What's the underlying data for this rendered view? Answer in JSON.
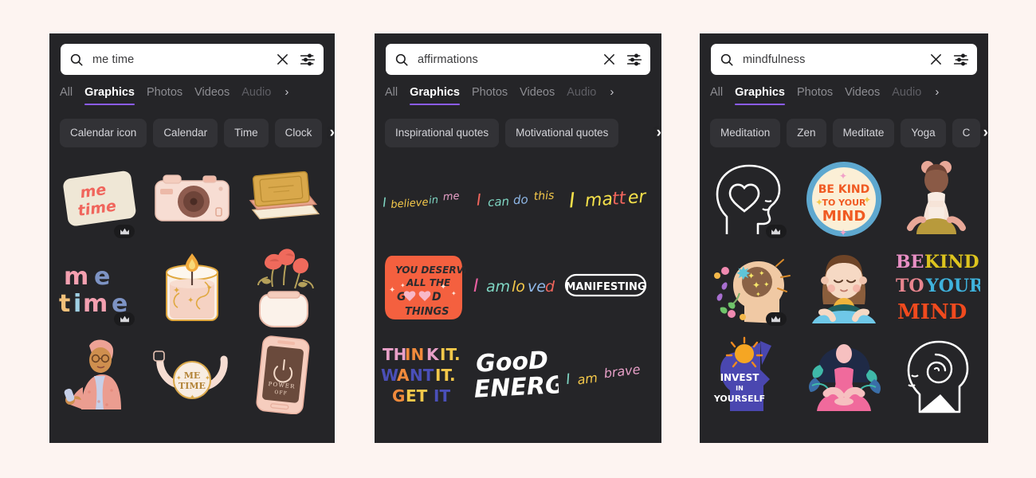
{
  "page": {
    "background": "#fdf4f1",
    "panel_background": "#252528",
    "accent": "#8b5cf6"
  },
  "panels": [
    {
      "id": "panel-me-time",
      "search": {
        "value": "me time",
        "placeholder": "Search",
        "search_icon": "search-icon",
        "clear_icon": "close-icon",
        "filter_icon": "sliders-icon"
      },
      "tabs": [
        {
          "label": "All",
          "active": false,
          "faded": false
        },
        {
          "label": "Graphics",
          "active": true,
          "faded": false
        },
        {
          "label": "Photos",
          "active": false,
          "faded": false
        },
        {
          "label": "Videos",
          "active": false,
          "faded": false
        },
        {
          "label": "Audio",
          "active": false,
          "faded": true
        }
      ],
      "tabs_more": "›",
      "chips": [
        "Calendar icon",
        "Calendar",
        "Time",
        "Clock"
      ],
      "chips_more": "›",
      "results": [
        {
          "name": "me-time-lettering-card",
          "premium": true
        },
        {
          "name": "pink-camera",
          "premium": false
        },
        {
          "name": "stacked-books",
          "premium": false
        },
        {
          "name": "me-time-bubble-lettering",
          "premium": true
        },
        {
          "name": "lit-candle",
          "premium": false
        },
        {
          "name": "flowers-in-vase",
          "premium": false
        },
        {
          "name": "woman-in-robe-reading",
          "premium": false
        },
        {
          "name": "me-time-badge-hands",
          "premium": false
        },
        {
          "name": "phone-power-off",
          "premium": false
        }
      ]
    },
    {
      "id": "panel-affirmations",
      "search": {
        "value": "affirmations",
        "placeholder": "Search",
        "search_icon": "search-icon",
        "clear_icon": "close-icon",
        "filter_icon": "sliders-icon"
      },
      "tabs": [
        {
          "label": "All",
          "active": false,
          "faded": false
        },
        {
          "label": "Graphics",
          "active": true,
          "faded": false
        },
        {
          "label": "Photos",
          "active": false,
          "faded": false
        },
        {
          "label": "Videos",
          "active": false,
          "faded": false
        },
        {
          "label": "Audio",
          "active": false,
          "faded": true
        }
      ],
      "tabs_more": "›",
      "chips": [
        "Inspirational quotes",
        "Motivational quotes"
      ],
      "chips_more": "›",
      "text_results": [
        [
          {
            "text": "I believe in me",
            "name": "i-believe-in-me-lettering",
            "colors": [
              "#7fd6c3",
              "#f4c84a",
              "#7fd6c3",
              "#e8a0c8"
            ],
            "size": 15,
            "style": "script"
          },
          {
            "text": "I can do this",
            "name": "i-can-do-this-lettering",
            "colors": [
              "#f0655c",
              "#7fd6c3",
              "#8fb8e8",
              "#f4c84a"
            ],
            "size": 17,
            "style": "script"
          },
          {
            "text": "I matter",
            "name": "i-matter-lettering",
            "colors": [
              "#f4e04a",
              "#f4e04a",
              "#f0655c"
            ],
            "size": 23,
            "style": "script"
          }
        ],
        [
          {
            "text": "YOU DESERVE ALL THE GOOD THINGS",
            "name": "you-deserve-all-the-good-things-sticker",
            "colors": [
              "#f4603f"
            ],
            "size": 12,
            "style": "badge"
          },
          {
            "text": "I am loved",
            "name": "i-am-loved-lettering",
            "colors": [
              "#e85fa0",
              "#7fd6c3",
              "#f4c84a",
              "#8fb8e8",
              "#f0655c"
            ],
            "size": 20,
            "style": "script"
          },
          {
            "text": "MANIFESTING",
            "name": "manifesting-sticker",
            "colors": [
              "#ffffff"
            ],
            "size": 13,
            "style": "outline"
          }
        ],
        [
          {
            "text": "THINK IT. WANT IT. GET IT",
            "name": "think-it-want-it-get-it-lettering",
            "colors": [
              "#e8a0c8",
              "#f08a3c",
              "#4a4fb8",
              "#f4c84a",
              "#f0655c"
            ],
            "size": 19,
            "style": "block"
          },
          {
            "text": "GOOD ENERGY",
            "name": "good-energy-lettering",
            "colors": [
              "#ffffff"
            ],
            "size": 26,
            "style": "brush"
          },
          {
            "text": "I am brave",
            "name": "i-am-brave-lettering",
            "colors": [
              "#7fd6c3",
              "#f4c84a",
              "#e8a0c8"
            ],
            "size": 16,
            "style": "script"
          }
        ]
      ]
    },
    {
      "id": "panel-mindfulness",
      "search": {
        "value": "mindfulness",
        "placeholder": "Search",
        "search_icon": "search-icon",
        "clear_icon": "close-icon",
        "filter_icon": "sliders-icon"
      },
      "tabs": [
        {
          "label": "All",
          "active": false,
          "faded": false
        },
        {
          "label": "Graphics",
          "active": true,
          "faded": false
        },
        {
          "label": "Photos",
          "active": false,
          "faded": false
        },
        {
          "label": "Videos",
          "active": false,
          "faded": false
        },
        {
          "label": "Audio",
          "active": false,
          "faded": true
        }
      ],
      "tabs_more": "›",
      "chips": [
        "Meditation",
        "Zen",
        "Meditate",
        "Yoga",
        "C"
      ],
      "chips_more": "›",
      "results": [
        {
          "name": "head-outline-with-heart",
          "premium": true
        },
        {
          "name": "be-kind-to-your-mind-badge",
          "premium": false,
          "label": "BE KIND TO YOUR MIND"
        },
        {
          "name": "woman-meditating-tan",
          "premium": false
        },
        {
          "name": "head-with-sparkly-brain-flowers",
          "premium": true
        },
        {
          "name": "girl-meditating-cartoon",
          "premium": false
        },
        {
          "name": "be-kind-to-your-mind-retro-type",
          "premium": false,
          "label": "BE KIND TO YOUR MIND"
        },
        {
          "name": "invest-in-yourself-head",
          "premium": false,
          "label": "INVEST IN YOURSELF"
        },
        {
          "name": "woman-meditating-with-leaves",
          "premium": false
        },
        {
          "name": "head-outline-with-spiral",
          "premium": false
        }
      ]
    }
  ]
}
